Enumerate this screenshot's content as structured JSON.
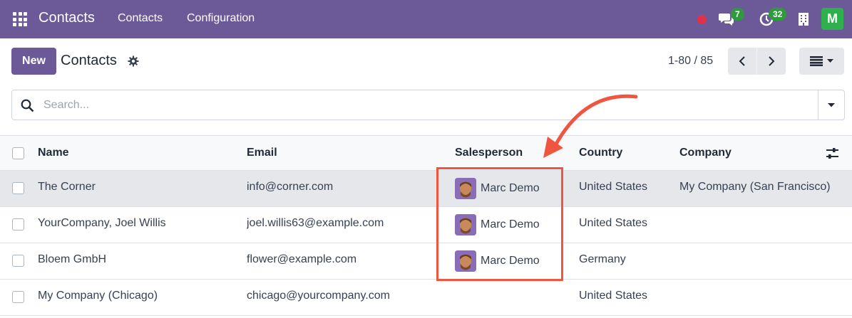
{
  "navbar": {
    "brand": "Contacts",
    "menu": [
      "Contacts",
      "Configuration"
    ],
    "messages_count": "7",
    "activities_count": "32",
    "user_initial": "M",
    "colors": {
      "bar": "#6c5a98",
      "badge": "#2e9a3c",
      "record": "#e0314b",
      "avatar": "#2eb04d"
    }
  },
  "control_panel": {
    "new_label": "New",
    "title": "Contacts",
    "pager": "1-80 / 85"
  },
  "search": {
    "placeholder": "Search..."
  },
  "table": {
    "headers": [
      "Name",
      "Email",
      "Salesperson",
      "Country",
      "Company"
    ],
    "rows": [
      {
        "name": "The Corner",
        "email": "info@corner.com",
        "salesperson": "Marc Demo",
        "country": "United States",
        "company": "My Company (San Francisco)"
      },
      {
        "name": "YourCompany, Joel Willis",
        "email": "joel.willis63@example.com",
        "salesperson": "Marc Demo",
        "country": "United States",
        "company": ""
      },
      {
        "name": "Bloem GmbH",
        "email": "flower@example.com",
        "salesperson": "Marc Demo",
        "country": "Germany",
        "company": ""
      },
      {
        "name": "My Company (Chicago)",
        "email": "chicago@yourcompany.com",
        "salesperson": "",
        "country": "United States",
        "company": ""
      }
    ]
  },
  "annotation": {
    "color": "#f05540"
  }
}
